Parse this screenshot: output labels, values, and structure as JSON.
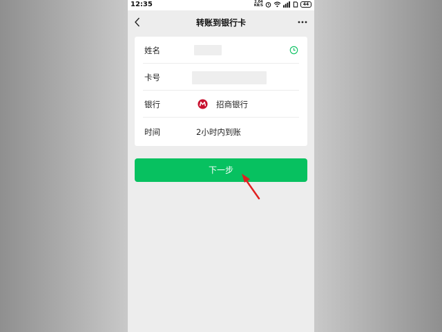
{
  "status_bar": {
    "time": "12:35",
    "speed_value": "2.04",
    "speed_unit": "KB/S",
    "battery": "44"
  },
  "nav": {
    "title": "转账到银行卡",
    "back_icon": "chevron-left-icon",
    "more_icon": "more-dots-icon"
  },
  "form": {
    "name_label": "姓名",
    "card_label": "卡号",
    "bank_label": "银行",
    "bank_name": "招商银行",
    "time_label": "时间",
    "time_value": "2小时内到账"
  },
  "next_button": {
    "label": "下一步"
  },
  "colors": {
    "accent": "#07c160",
    "annotation_arrow": "#e02020",
    "bank_logo": "#c8102e"
  }
}
